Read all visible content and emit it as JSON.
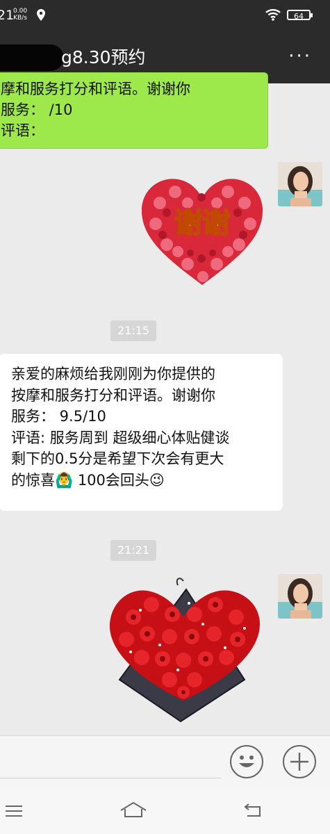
{
  "status_bar": {
    "time": "21",
    "net_speed": "0.00",
    "net_unit": "KB/s",
    "battery": "64",
    "icons": [
      "location-icon",
      "wifi-icon",
      "battery-icon"
    ]
  },
  "header": {
    "title": "g8.30预约",
    "more_label": "···"
  },
  "messages": {
    "top_bubble": {
      "line1": "摩和服务打分和评语。谢谢你",
      "line2": "服务：  /10",
      "line3": "评语："
    },
    "sticker1_text": "谢谢",
    "time1": "21:15",
    "reply": {
      "line1": "亲爱的麻烦给我刚刚为你提供的",
      "line2": "按摩和服务打分和评语。谢谢你",
      "line3": "服务：  9.5/10",
      "line4": "评语: 服务周到 超级细心体贴健谈",
      "line5": "剩下的0.5分是希望下次会有更大",
      "line6": "的惊喜🙆‍♂️ 100会回头😉"
    },
    "time2": "21:21"
  },
  "colors": {
    "bar": "#2b2b2b",
    "bubble_green": "#9de84b",
    "bubble_white": "#ffffff",
    "background": "#ebebeb"
  }
}
